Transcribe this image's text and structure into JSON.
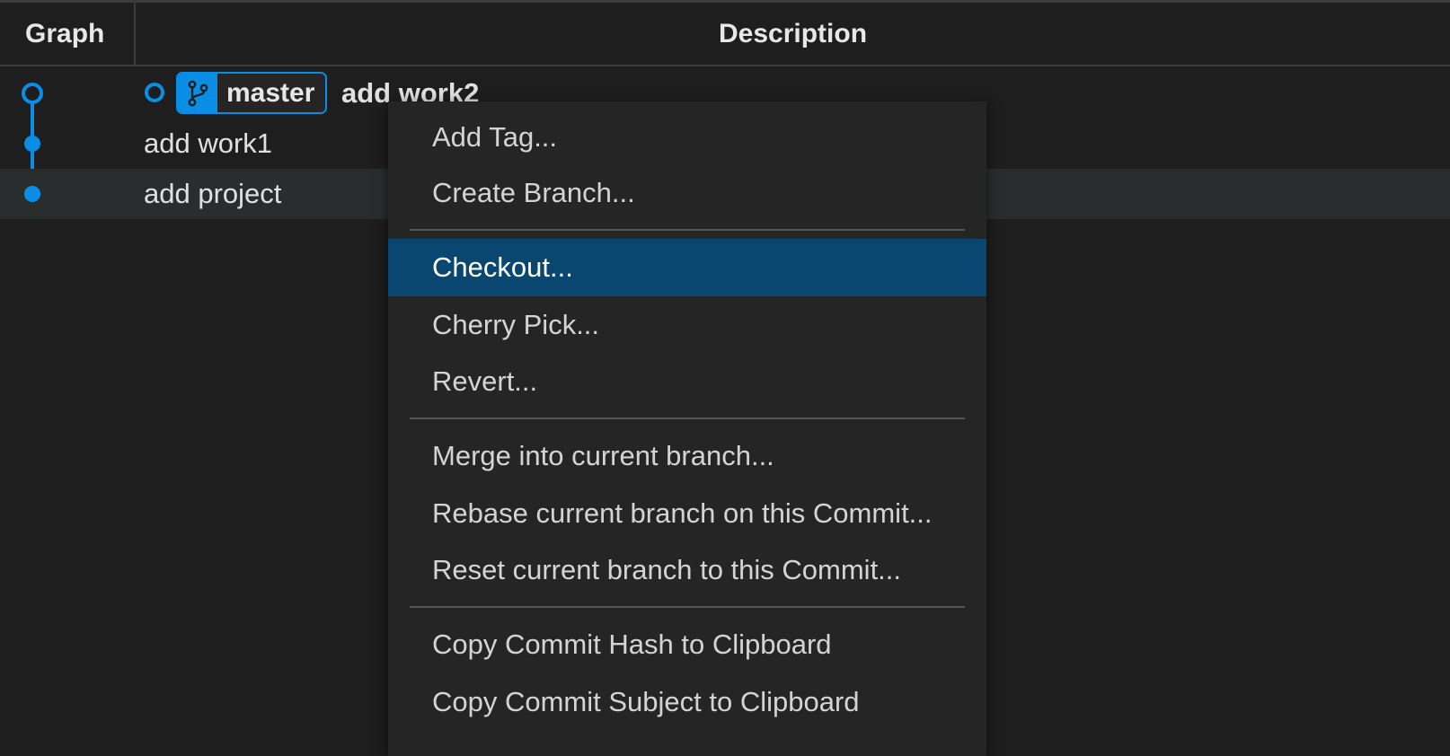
{
  "header": {
    "graph_label": "Graph",
    "description_label": "Description"
  },
  "commits": [
    {
      "subject": "add work2",
      "branch": "master",
      "is_head": true
    },
    {
      "subject": "add work1"
    },
    {
      "subject": "add project",
      "selected": true
    }
  ],
  "context_menu": {
    "items": [
      {
        "label": "Add Tag..."
      },
      {
        "label": "Create Branch..."
      },
      {
        "label": "Checkout...",
        "active": true
      },
      {
        "label": "Cherry Pick..."
      },
      {
        "label": "Revert..."
      },
      {
        "label": "Merge into current branch..."
      },
      {
        "label": "Rebase current branch on this Commit..."
      },
      {
        "label": "Reset current branch to this Commit..."
      },
      {
        "label": "Copy Commit Hash to Clipboard"
      },
      {
        "label": "Copy Commit Subject to Clipboard"
      }
    ]
  },
  "colors": {
    "accent": "#0a8ee5",
    "menu_highlight": "#094771",
    "background": "#1e1e1e"
  }
}
